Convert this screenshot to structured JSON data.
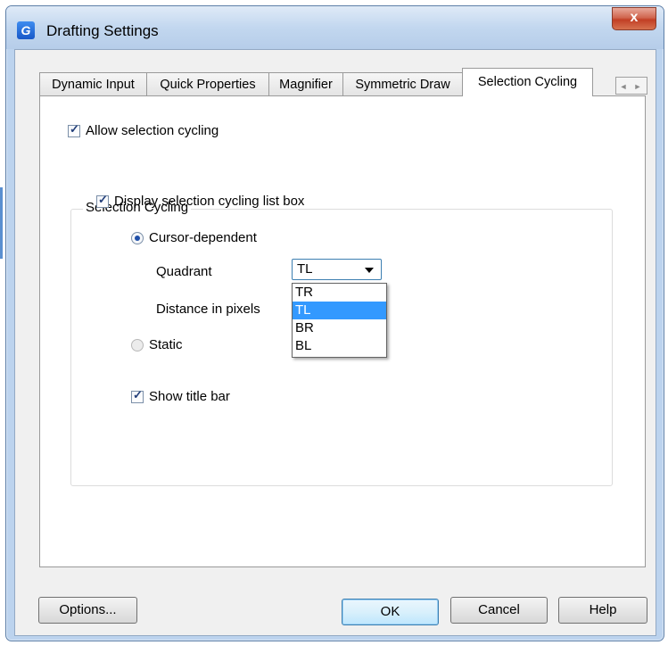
{
  "window": {
    "title": "Drafting Settings",
    "app_icon_letter": "G",
    "close_glyph": "x"
  },
  "tabs": [
    {
      "label": "Dynamic Input",
      "active": false
    },
    {
      "label": "Quick Properties",
      "active": false
    },
    {
      "label": "Magnifier",
      "active": false
    },
    {
      "label": "Symmetric Draw",
      "active": false
    },
    {
      "label": "Selection Cycling",
      "active": true
    }
  ],
  "tab_scroll": {
    "left": "◄",
    "right": "►"
  },
  "panel": {
    "allow_selection_cycling": {
      "label": "Allow selection cycling",
      "checked": true
    },
    "group": {
      "title": "Selection Cycling",
      "display_list_box": {
        "label": "Display selection cycling list box",
        "checked": true
      },
      "cursor_dependent": {
        "label": "Cursor-dependent",
        "selected": true
      },
      "quadrant": {
        "label": "Quadrant",
        "value": "TL",
        "options": [
          "TR",
          "TL",
          "BR",
          "BL"
        ],
        "highlighted": "TL"
      },
      "distance_label": "Distance in pixels",
      "static": {
        "label": "Static",
        "selected": false
      },
      "show_title_bar": {
        "label": "Show title bar",
        "checked": true
      }
    }
  },
  "buttons": {
    "options": "Options...",
    "ok": "OK",
    "cancel": "Cancel",
    "help": "Help"
  },
  "colors": {
    "selection_highlight": "#3399ff",
    "window_frame": "#bcd3ee",
    "close_button": "#c23f25"
  }
}
